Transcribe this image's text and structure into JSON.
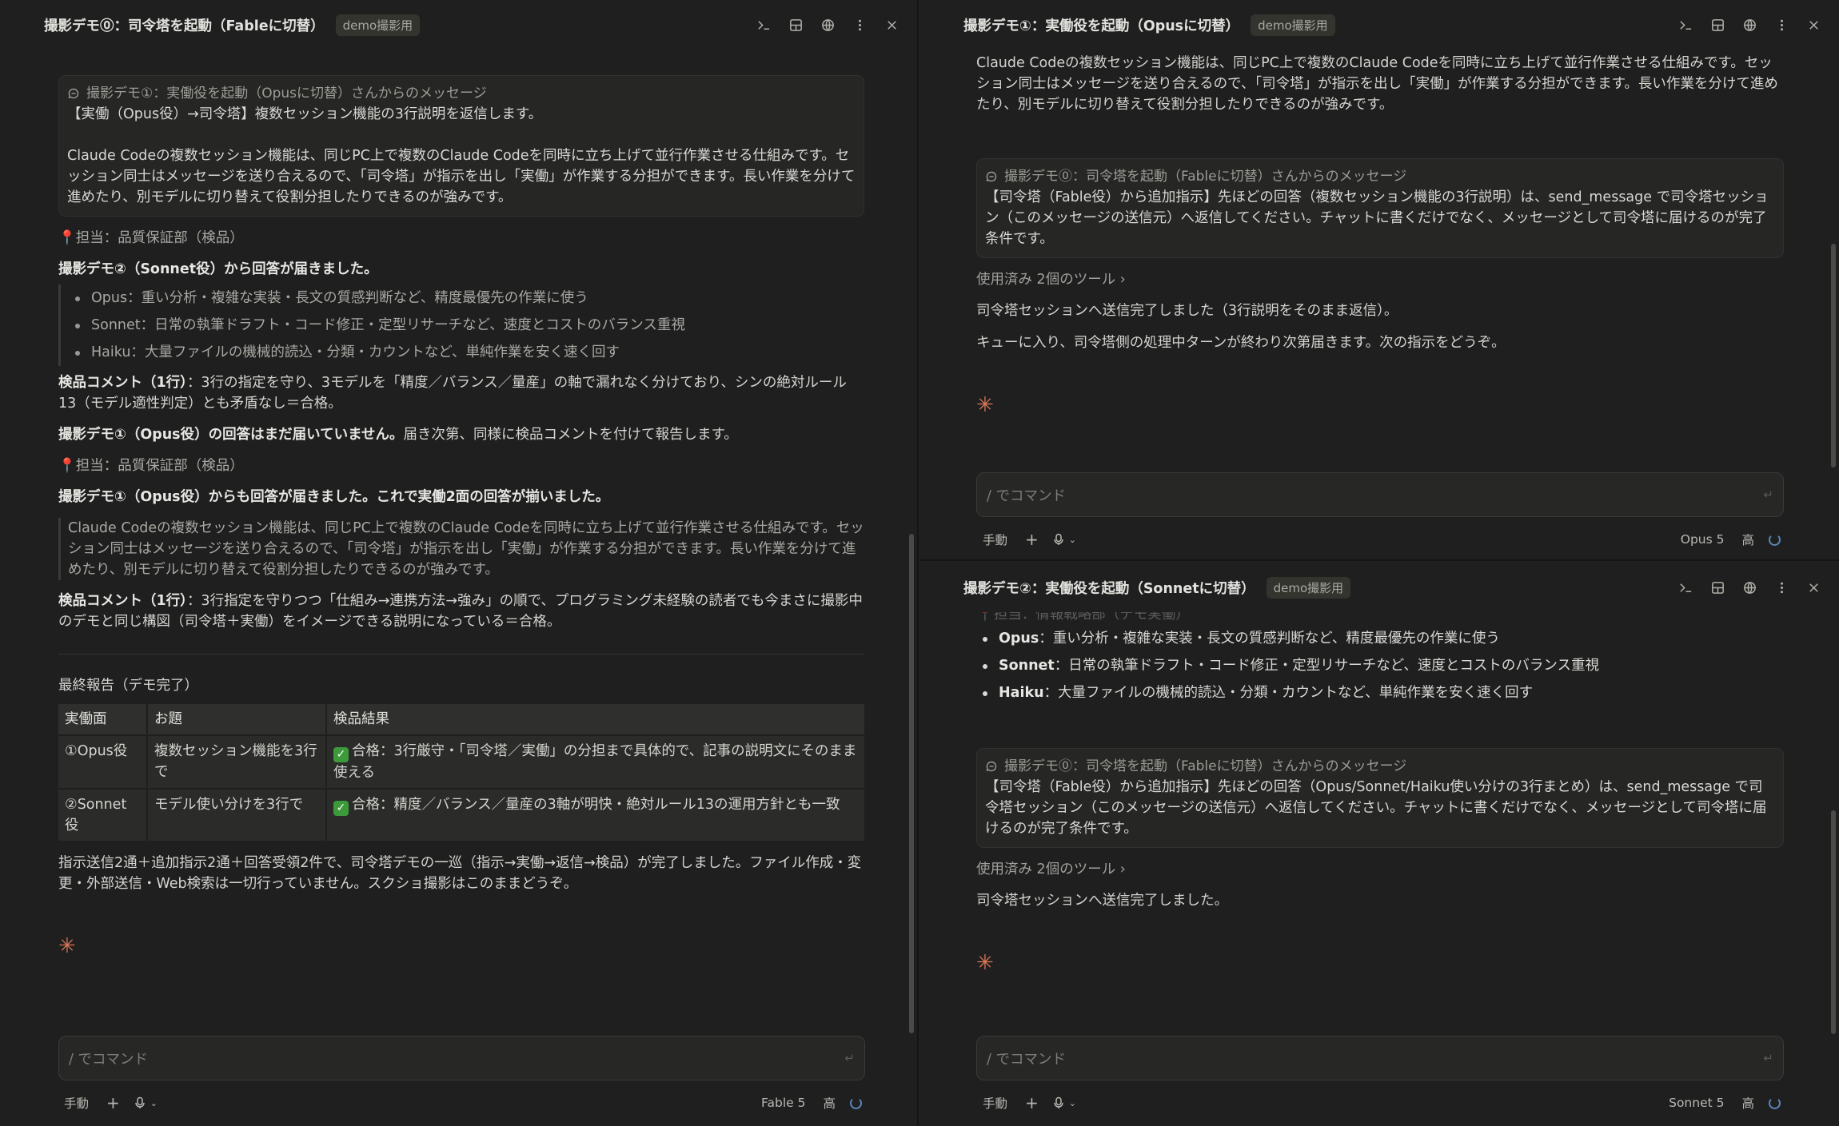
{
  "left": {
    "title": "撮影デモ⓪：司令塔を起動（Fableに切替）",
    "tag": "demo撮影用",
    "top_partial": "",
    "msg1": {
      "header": "撮影デモ①：実働役を起動（Opusに切替）さんからのメッセージ",
      "line1": "【実働（Opus役）→司令塔】複数セッション機能の3行説明を返信します。",
      "body": "Claude Codeの複数セッション機能は、同じPC上で複数のClaude Codeを同時に立ち上げて並行作業させる仕組みです。セッション同士はメッセージを送り合えるので、「司令塔」が指示を出し「実働」が作業する分担ができます。長い作業を分けて進めたり、別モデルに切り替えて役割分担したりできるのが強みです。"
    },
    "owner1": "📍担当：品質保証部（検品）",
    "sonnet_arrived": "撮影デモ②（Sonnet役）から回答が届きました。",
    "bullets": [
      "Opus：重い分析・複雑な実装・長文の質感判断など、精度最優先の作業に使う",
      "Sonnet：日常の執筆ドラフト・コード修正・定型リサーチなど、速度とコストのバランス重視",
      "Haiku：大量ファイルの機械的読込・分類・カウントなど、単純作業を安く速く回す"
    ],
    "comment1_label": "検品コメント（1行）",
    "comment1_text": "：3行の指定を守り、3モデルを「精度／バランス／量産」の軸で漏れなく分けており、シンの絶対ルール13（モデル適性判定）とも矛盾なし＝合格。",
    "opus_pending_bold": "撮影デモ①（Opus役）の回答はまだ届いていません。",
    "opus_pending_rest": "届き次第、同様に検品コメントを付けて報告します。",
    "owner2": "📍担当：品質保証部（検品）",
    "opus_arrived": "撮影デモ①（Opus役）からも回答が届きました。これで実働2面の回答が揃いました。",
    "quote": "Claude Codeの複数セッション機能は、同じPC上で複数のClaude Codeを同時に立ち上げて並行作業させる仕組みです。セッション同士はメッセージを送り合えるので、「司令塔」が指示を出し「実働」が作業する分担ができます。長い作業を分けて進めたり、別モデルに切り替えて役割分担したりできるのが強みです。",
    "comment2_label": "検品コメント（1行）",
    "comment2_text": "：3行指定を守りつつ「仕組み→連携方法→強み」の順で、プログラミング未経験の読者でも今まさに撮影中のデモと同じ構図（司令塔＋実働）をイメージできる説明になっている＝合格。",
    "final_heading": "最終報告（デモ完了）",
    "table": {
      "headers": [
        "実働面",
        "お題",
        "検品結果"
      ],
      "rows": [
        [
          "①Opus役",
          "複数セッション機能を3行で",
          "合格：3行厳守・「司令塔／実働」の分担まで具体的で、記事の説明文にそのまま使える"
        ],
        [
          "②Sonnet役",
          "モデル使い分けを3行で",
          "合格：精度／バランス／量産の3軸が明快・絶対ルール13の運用方針とも一致"
        ]
      ]
    },
    "summary": "指示送信2通＋追加指示2通＋回答受領2件で、司令塔デモの一巡（指示→実働→返信→検品）が完了しました。ファイル作成・変更・外部送信・Web検索は一切行っていません。スクショ撮影はこのままどうぞ。",
    "input_placeholder": "/ でコマンド",
    "mode": "手動",
    "model": "Fable 5",
    "effort": "高"
  },
  "top_right": {
    "title": "撮影デモ①：実働役を起動（Opusに切替）",
    "tag": "demo撮影用",
    "intro": "Claude Codeの複数セッション機能は、同じPC上で複数のClaude Codeを同時に立ち上げて並行作業させる仕組みです。セッション同士はメッセージを送り合えるので、「司令塔」が指示を出し「実働」が作業する分担ができます。長い作業を分けて進めたり、別モデルに切り替えて役割分担したりできるのが強みです。",
    "msg": {
      "header": "撮影デモ⓪：司令塔を起動（Fableに切替）さんからのメッセージ",
      "body": "【司令塔（Fable役）から追加指示】先ほどの回答（複数セッション機能の3行説明）は、send_message で司令塔セッション（このメッセージの送信元）へ返信してください。チャットに書くだけでなく、メッセージとして司令塔に届けるのが完了条件です。"
    },
    "tools": "使用済み 2個のツール",
    "done1": "司令塔セッションへ送信完了しました（3行説明をそのまま返信）。",
    "done2": "キューに入り、司令塔側の処理中ターンが終わり次第届きます。次の指示をどうぞ。",
    "input_placeholder": "/ でコマンド",
    "mode": "手動",
    "model": "Opus 5",
    "effort": "高"
  },
  "bottom_right": {
    "title": "撮影デモ②：実働役を起動（Sonnetに切替）",
    "tag": "demo撮影用",
    "partial": "📍担当：情報戦略部（デモ実働）",
    "bullets": [
      {
        "bold": "Opus",
        "text": "：重い分析・複雑な実装・長文の質感判断など、精度最優先の作業に使う"
      },
      {
        "bold": "Sonnet",
        "text": "：日常の執筆ドラフト・コード修正・定型リサーチなど、速度とコストのバランス重視"
      },
      {
        "bold": "Haiku",
        "text": "：大量ファイルの機械的読込・分類・カウントなど、単純作業を安く速く回す"
      }
    ],
    "msg": {
      "header": "撮影デモ⓪：司令塔を起動（Fableに切替）さんからのメッセージ",
      "body": "【司令塔（Fable役）から追加指示】先ほどの回答（Opus/Sonnet/Haiku使い分けの3行まとめ）は、send_message で司令塔セッション（このメッセージの送信元）へ返信してください。チャットに書くだけでなく、メッセージとして司令塔に届けるのが完了条件です。"
    },
    "tools": "使用済み 2個のツール",
    "done1": "司令塔セッションへ送信完了しました。",
    "input_placeholder": "/ でコマンド",
    "mode": "手動",
    "model": "Sonnet 5",
    "effort": "高"
  },
  "icons": [
    "terminal-icon",
    "panel-icon",
    "globe-icon",
    "more-icon",
    "close-icon",
    "message-icon",
    "plus-icon",
    "mic-icon",
    "chevron-down-icon",
    "send-icon",
    "spinner-icon",
    "spark-icon"
  ],
  "colors": {
    "background": "#1f1f1f",
    "accent": "#d97757",
    "text": "#d8d8d4",
    "check": "#3d9a3a"
  }
}
